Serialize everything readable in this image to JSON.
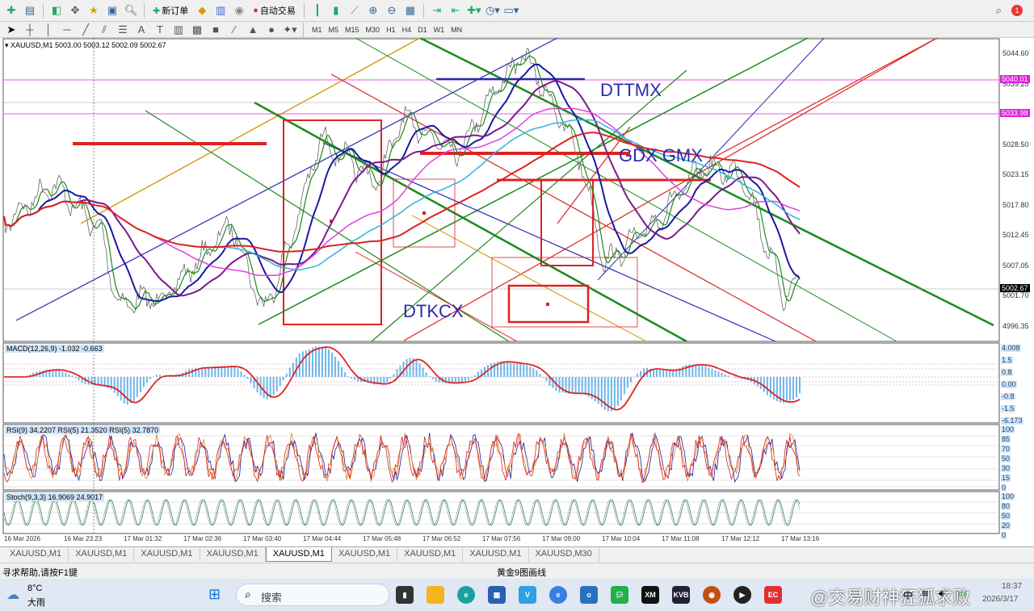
{
  "toolbar": {
    "new_order": "新订单",
    "auto_trade": "自动交易",
    "timeframes": [
      "M1",
      "M5",
      "M15",
      "M30",
      "H1",
      "H4",
      "D1",
      "W1",
      "MN"
    ]
  },
  "chart": {
    "header": "XAUUSD,M1  5003.00 5003.12 5002.09 5002.67",
    "price_ticks": [
      "5044.60",
      "5039.25",
      "5033.90",
      "5028.50",
      "5023.15",
      "5017.80",
      "5012.45",
      "5007.05",
      "5001.70",
      "4996.35"
    ],
    "price_labels": {
      "line1": "5040.01",
      "line2": "5033.98",
      "current": "5002.67"
    },
    "annotations": {
      "a": "DTTMX",
      "b": "GDX GMX",
      "c": "DTKCX"
    },
    "time_ticks": [
      "16 Mar 2026",
      "16 Mar 23:23",
      "17 Mar 01:32",
      "17 Mar 02:36",
      "17 Mar 03:40",
      "17 Mar 04:44",
      "17 Mar 05:48",
      "17 Mar 06:52",
      "17 Mar 07:56",
      "17 Mar 09:00",
      "17 Mar 10:04",
      "17 Mar 11:08",
      "17 Mar 12:12",
      "17 Mar 13:16"
    ]
  },
  "macd": {
    "title": "MACD(12,26,9) -1.032 -0.663",
    "ticks": [
      "4.008",
      "1.5",
      "0.8",
      "0.00",
      "-0.8",
      "-1.5",
      "-6.173"
    ]
  },
  "rsi": {
    "title": "RSI(9) 34.2207  RSI(5) 21.3520  RSI(5) 32.7870",
    "ticks": [
      "100",
      "85",
      "70",
      "50",
      "30",
      "15",
      "0"
    ]
  },
  "stoch": {
    "title": "Stoch(9,3,3) 16.9069 24.9017",
    "ticks": [
      "100",
      "80",
      "50",
      "20",
      "0"
    ]
  },
  "tabs": [
    "XAUUSD,M1",
    "XAUUSD,M1",
    "XAUUSD,M1",
    "XAUUSD,M1",
    "XAUUSD,M1",
    "XAUUSD,M1",
    "XAUUSD,M1",
    "XAUUSD,M1",
    "XAUUSD,M30"
  ],
  "active_tab": 4,
  "status": {
    "help": "寻求帮助,请按F1键",
    "profile": "黄金9图画线"
  },
  "taskbar": {
    "weather_temp": "8°C",
    "weather_desc": "大雨",
    "search": "搜索",
    "ime": "中",
    "time": "18:37",
    "date": "2026/3/17",
    "watermark": "@交易财神狂狐求败"
  },
  "colors": {
    "up": "#1f8f1f",
    "down": "#d81e1e",
    "accent": "#e020e0"
  }
}
